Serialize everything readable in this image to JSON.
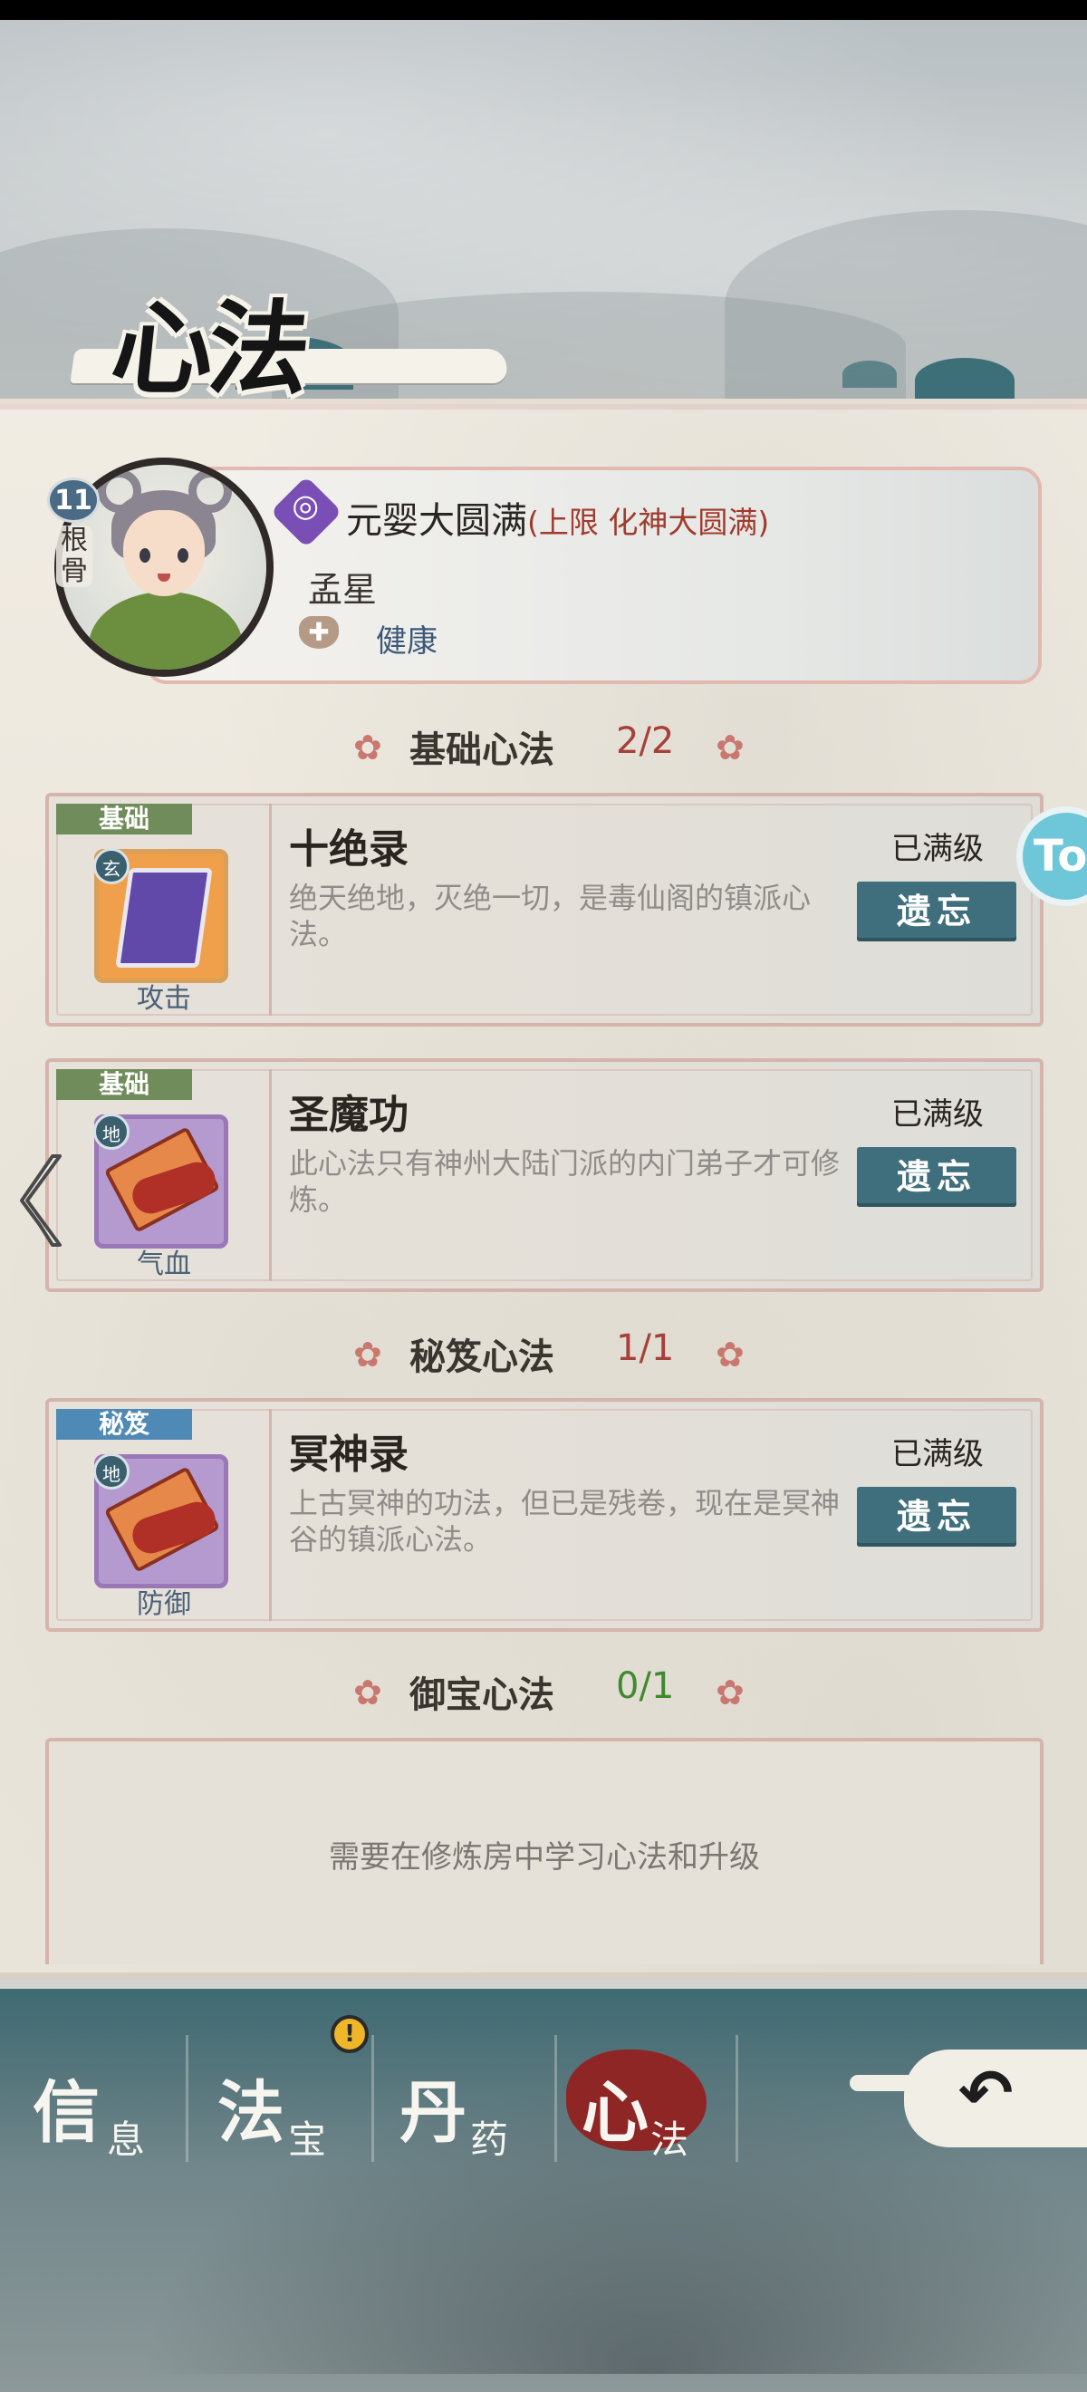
{
  "title": "心法",
  "character": {
    "level": "11",
    "rootbone_label": "根骨",
    "realm": "元婴大圆满",
    "realm_cap": "(上限 化神大圆满)",
    "name": "孟星",
    "health_status": "健康",
    "health_icon_glyph": "✚"
  },
  "sections": [
    {
      "label": "基础心法",
      "count": "2/2",
      "count_color": "#a5403a",
      "skills": [
        {
          "tag": "基础",
          "name": "十绝录",
          "desc": "绝天绝地，灭绝一切，是毒仙阁的镇派心法。",
          "type": "攻击",
          "grade": "玄",
          "status": "已满级",
          "button": "遗忘",
          "icon": "purple-book-icon"
        },
        {
          "tag": "基础",
          "name": "圣魔功",
          "desc": "此心法只有神州大陆门派的内门弟子才可修炼。",
          "type": "气血",
          "grade": "地",
          "status": "已满级",
          "button": "遗忘",
          "icon": "scroll-icon"
        }
      ]
    },
    {
      "label": "秘笈心法",
      "count": "1/1",
      "count_color": "#a5403a",
      "skills": [
        {
          "tag": "秘笈",
          "name": "冥神录",
          "desc": "上古冥神的功法，但已是残卷，现在是冥神谷的镇派心法。",
          "type": "防御",
          "grade": "地",
          "status": "已满级",
          "button": "遗忘",
          "icon": "scroll-icon"
        }
      ]
    },
    {
      "label": "御宝心法",
      "count": "0/1",
      "count_color": "#3f8a2e",
      "empty_text": "需要在修炼房中学习心法和升级"
    }
  ],
  "floating_button": "To",
  "nav": {
    "tabs": [
      {
        "big": "信",
        "small": "息"
      },
      {
        "big": "法",
        "small": "宝"
      },
      {
        "big": "丹",
        "small": "药"
      },
      {
        "big": "心",
        "small": "法"
      }
    ],
    "active": "心法",
    "alert_glyph": "!",
    "back_glyph": "↶"
  },
  "colors": {
    "accent_teal": "#3f6f7c",
    "tag_green": "#6f8c5a",
    "tag_blue": "#4f89b5",
    "border_pink": "#d5b4ac",
    "active_tab": "#8f2626"
  }
}
